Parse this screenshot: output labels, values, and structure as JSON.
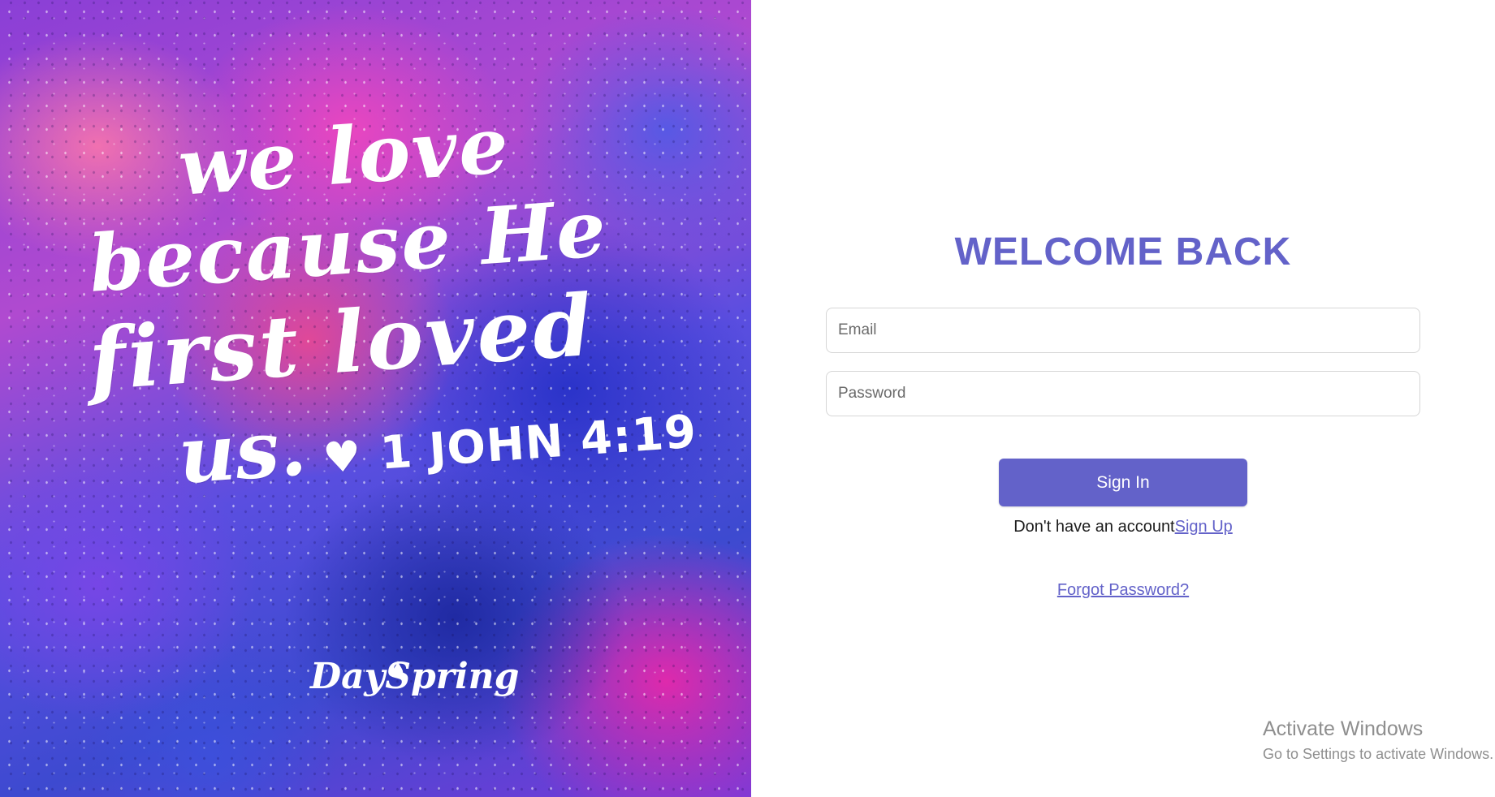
{
  "art": {
    "quote_line1": "we love",
    "quote_line2": "because He",
    "quote_line3": "first loved",
    "quote_line4": "us.",
    "heart_icon": "heart-icon",
    "reference": "1 JOHN 4:19",
    "brand": "DaySpring"
  },
  "login": {
    "title": "WELCOME BACK",
    "email_placeholder": "Email",
    "password_placeholder": "Password",
    "signin_label": "Sign In",
    "signup_prompt": "Don't have an account",
    "signup_link": "Sign Up",
    "forgot_link": "Forgot Password?"
  },
  "watermark": {
    "line1": "Activate Windows",
    "line2": "Go to Settings to activate Windows."
  },
  "colors": {
    "accent": "#6362c9",
    "text": "#1d1d1d",
    "border": "#d6d6d6"
  }
}
